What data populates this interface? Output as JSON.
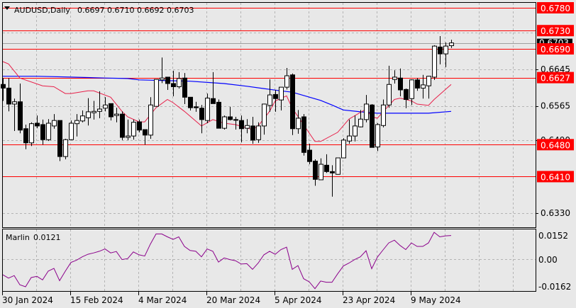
{
  "header": {
    "symbol_timeframe": "AUDUSD,Daily",
    "ohlc": "0.6697 0.6710 0.6692 0.6703"
  },
  "colors": {
    "background": "#e8e8e8",
    "levels": "#ff0000",
    "ma_fast": "#e8204a",
    "ma_slow": "#0000ff",
    "indicator": "#8b008b",
    "bull_body": "#ffffff",
    "bear_body": "#000000"
  },
  "chart_data": [
    {
      "type": "candlestick",
      "title": "AUDUSD,Daily",
      "ylim": [
        0.629,
        0.68
      ],
      "grid": true,
      "x_tick_labels": [
        {
          "bar": 0,
          "label": "30 Jan 2024"
        },
        {
          "bar": 12,
          "label": "15 Feb 2024"
        },
        {
          "bar": 24,
          "label": "4 Mar 2024"
        },
        {
          "bar": 36,
          "label": "20 Mar 2024"
        },
        {
          "bar": 48,
          "label": "5 Apr 2024"
        },
        {
          "bar": 60,
          "label": "23 Apr 2024"
        },
        {
          "bar": 72,
          "label": "9 May 2024"
        }
      ],
      "y_tick_labels": [
        "0.6645",
        "0.6565",
        "0.6490",
        "0.6330"
      ],
      "y_grid": [
        0.6725,
        0.6645,
        0.6565,
        0.649,
        0.641,
        0.633
      ],
      "levels": [
        "0.6780",
        "0.6730",
        "0.6690",
        "0.6627",
        "0.6480",
        "0.6410"
      ],
      "current_price": "0.6703",
      "ohlc": [
        [
          0.6612,
          0.6626,
          0.6576,
          0.6604
        ],
        [
          0.6604,
          0.6626,
          0.6553,
          0.6569
        ],
        [
          0.6569,
          0.6581,
          0.651,
          0.6574
        ],
        [
          0.6574,
          0.6614,
          0.6505,
          0.6512
        ],
        [
          0.6515,
          0.6524,
          0.647,
          0.6484
        ],
        [
          0.6484,
          0.6529,
          0.6477,
          0.6526
        ],
        [
          0.6527,
          0.6544,
          0.6516,
          0.6521
        ],
        [
          0.6524,
          0.6535,
          0.648,
          0.6491
        ],
        [
          0.6491,
          0.6536,
          0.6488,
          0.6527
        ],
        [
          0.6521,
          0.6547,
          0.6515,
          0.6533
        ],
        [
          0.6533,
          0.6533,
          0.6444,
          0.6454
        ],
        [
          0.6454,
          0.6493,
          0.6448,
          0.6491
        ],
        [
          0.6491,
          0.6533,
          0.649,
          0.6527
        ],
        [
          0.6526,
          0.6547,
          0.6498,
          0.6533
        ],
        [
          0.6532,
          0.6555,
          0.6529,
          0.6543
        ],
        [
          0.6539,
          0.6582,
          0.6522,
          0.6552
        ],
        [
          0.655,
          0.6576,
          0.6535,
          0.6553
        ],
        [
          0.6553,
          0.6597,
          0.6538,
          0.6558
        ],
        [
          0.656,
          0.6584,
          0.6553,
          0.6567
        ],
        [
          0.657,
          0.657,
          0.6533,
          0.6541
        ],
        [
          0.6544,
          0.6561,
          0.6529,
          0.6547
        ],
        [
          0.6547,
          0.6553,
          0.649,
          0.6496
        ],
        [
          0.6496,
          0.6535,
          0.649,
          0.6499
        ],
        [
          0.6499,
          0.6535,
          0.6491,
          0.6529
        ],
        [
          0.653,
          0.6535,
          0.6507,
          0.6512
        ],
        [
          0.6513,
          0.6513,
          0.648,
          0.6501
        ],
        [
          0.6501,
          0.6584,
          0.6493,
          0.6567
        ],
        [
          0.6564,
          0.6623,
          0.6564,
          0.6623
        ],
        [
          0.6622,
          0.6671,
          0.6615,
          0.6626
        ],
        [
          0.6628,
          0.6628,
          0.66,
          0.6614
        ],
        [
          0.6614,
          0.6642,
          0.6586,
          0.6607
        ],
        [
          0.6607,
          0.6639,
          0.6603,
          0.6625
        ],
        [
          0.6626,
          0.6637,
          0.6569,
          0.6584
        ],
        [
          0.6584,
          0.6584,
          0.6555,
          0.6561
        ],
        [
          0.6563,
          0.6574,
          0.6552,
          0.6561
        ],
        [
          0.656,
          0.6567,
          0.6505,
          0.6535
        ],
        [
          0.6533,
          0.6592,
          0.6527,
          0.6582
        ],
        [
          0.6581,
          0.6639,
          0.657,
          0.657
        ],
        [
          0.6573,
          0.6579,
          0.6516,
          0.6516
        ],
        [
          0.6516,
          0.6544,
          0.6513,
          0.6541
        ],
        [
          0.6541,
          0.6563,
          0.6533,
          0.6535
        ],
        [
          0.6535,
          0.6541,
          0.6513,
          0.6535
        ],
        [
          0.6533,
          0.6544,
          0.6485,
          0.6515
        ],
        [
          0.6516,
          0.6536,
          0.6505,
          0.6522
        ],
        [
          0.6521,
          0.6541,
          0.6482,
          0.649
        ],
        [
          0.6491,
          0.6529,
          0.6484,
          0.6521
        ],
        [
          0.6521,
          0.657,
          0.6502,
          0.6569
        ],
        [
          0.6566,
          0.6623,
          0.6552,
          0.6589
        ],
        [
          0.659,
          0.66,
          0.6552,
          0.6581
        ],
        [
          0.6578,
          0.6606,
          0.6555,
          0.6606
        ],
        [
          0.6606,
          0.6648,
          0.6601,
          0.6631
        ],
        [
          0.6633,
          0.6636,
          0.6501,
          0.6515
        ],
        [
          0.6515,
          0.6556,
          0.6504,
          0.6538
        ],
        [
          0.6541,
          0.6547,
          0.6456,
          0.6463
        ],
        [
          0.6468,
          0.6482,
          0.6437,
          0.6443
        ],
        [
          0.6444,
          0.6448,
          0.639,
          0.6404
        ],
        [
          0.6403,
          0.645,
          0.6403,
          0.6437
        ],
        [
          0.6435,
          0.6459,
          0.6418,
          0.6421
        ],
        [
          0.6421,
          0.6435,
          0.6366,
          0.6418
        ],
        [
          0.6415,
          0.6451,
          0.6414,
          0.6451
        ],
        [
          0.6451,
          0.6494,
          0.6451,
          0.649
        ],
        [
          0.6488,
          0.6535,
          0.6482,
          0.6499
        ],
        [
          0.6499,
          0.6544,
          0.6487,
          0.6521
        ],
        [
          0.6519,
          0.6556,
          0.6518,
          0.6536
        ],
        [
          0.6535,
          0.6589,
          0.6529,
          0.6569
        ],
        [
          0.6567,
          0.6569,
          0.6474,
          0.6474
        ],
        [
          0.6475,
          0.6527,
          0.6466,
          0.6524
        ],
        [
          0.6522,
          0.6579,
          0.6518,
          0.6567
        ],
        [
          0.6567,
          0.6653,
          0.6561,
          0.6612
        ],
        [
          0.6623,
          0.6643,
          0.6614,
          0.6628
        ],
        [
          0.6626,
          0.6647,
          0.6586,
          0.66
        ],
        [
          0.6601,
          0.6603,
          0.656,
          0.6579
        ],
        [
          0.6581,
          0.6623,
          0.6567,
          0.6622
        ],
        [
          0.6622,
          0.6626,
          0.6598,
          0.6604
        ],
        [
          0.6604,
          0.6633,
          0.6581,
          0.6611
        ],
        [
          0.6609,
          0.6631,
          0.6581,
          0.663
        ],
        [
          0.6628,
          0.6698,
          0.6622,
          0.6696
        ],
        [
          0.6694,
          0.6718,
          0.6656,
          0.6679
        ],
        [
          0.6679,
          0.6704,
          0.665,
          0.6696
        ],
        [
          0.6697,
          0.671,
          0.6692,
          0.6703
        ]
      ],
      "ma_fast": [
        [
          0,
          0.6662
        ],
        [
          1,
          0.6657
        ],
        [
          3,
          0.6626
        ],
        [
          7,
          0.6609
        ],
        [
          9,
          0.6607
        ],
        [
          11,
          0.6592
        ],
        [
          12,
          0.6592
        ],
        [
          15,
          0.6598
        ],
        [
          16,
          0.6598
        ],
        [
          19,
          0.6584
        ],
        [
          21,
          0.6553
        ],
        [
          22,
          0.6541
        ],
        [
          24,
          0.653
        ],
        [
          25,
          0.653
        ],
        [
          27,
          0.6561
        ],
        [
          29,
          0.6579
        ],
        [
          30,
          0.6572
        ],
        [
          32,
          0.6553
        ],
        [
          35,
          0.6521
        ],
        [
          37,
          0.6535
        ],
        [
          39,
          0.6527
        ],
        [
          41,
          0.6524
        ],
        [
          44,
          0.6513
        ],
        [
          45,
          0.6521
        ],
        [
          47,
          0.6553
        ],
        [
          48,
          0.6576
        ],
        [
          50,
          0.6587
        ],
        [
          51,
          0.656
        ],
        [
          55,
          0.6487
        ],
        [
          56,
          0.6487
        ],
        [
          59,
          0.6507
        ],
        [
          61,
          0.6536
        ],
        [
          64,
          0.6558
        ],
        [
          65,
          0.6541
        ],
        [
          66,
          0.6538
        ],
        [
          67,
          0.6552
        ],
        [
          69,
          0.6579
        ],
        [
          70,
          0.6582
        ],
        [
          72,
          0.6576
        ],
        [
          73,
          0.6569
        ],
        [
          75,
          0.6566
        ],
        [
          76,
          0.6579
        ],
        [
          79,
          0.6612
        ]
      ],
      "ma_slow": [
        [
          0,
          0.663
        ],
        [
          6,
          0.663
        ],
        [
          12,
          0.6628
        ],
        [
          18,
          0.6626
        ],
        [
          22,
          0.6625
        ],
        [
          24,
          0.6622
        ],
        [
          33,
          0.6619
        ],
        [
          39,
          0.6614
        ],
        [
          43,
          0.6608
        ],
        [
          46,
          0.6603
        ],
        [
          49,
          0.6598
        ],
        [
          51,
          0.6595
        ],
        [
          56,
          0.6577
        ],
        [
          58,
          0.6567
        ],
        [
          60,
          0.6556
        ],
        [
          63,
          0.6552
        ],
        [
          66,
          0.6549
        ],
        [
          75,
          0.6549
        ],
        [
          79,
          0.6553
        ]
      ]
    },
    {
      "type": "line",
      "name": "Marlin",
      "current_value": "0.0121",
      "ylim": [
        -0.0162,
        0.0152
      ],
      "y_tick_labels": [
        "0.0152",
        "0.00",
        "-0.0162"
      ],
      "values": [
        -0.008,
        -0.0097,
        -0.0084,
        -0.0131,
        -0.0141,
        -0.0094,
        -0.0088,
        -0.0106,
        -0.0061,
        -0.0047,
        -0.011,
        -0.0062,
        -0.0017,
        -0.0005,
        0.0012,
        0.0025,
        0.0032,
        0.004,
        0.0052,
        0.0032,
        0.0039,
        -0.0002,
        0.0003,
        0.0037,
        0.0022,
        0.0016,
        0.0077,
        0.0129,
        0.0129,
        0.0114,
        0.0101,
        0.0114,
        0.0065,
        0.0044,
        0.004,
        0.0012,
        0.0052,
        0.004,
        -0.0015,
        0.0006,
        -0.0002,
        -0.0008,
        -0.0025,
        -0.0023,
        -0.0052,
        -0.002,
        0.0022,
        0.004,
        0.0025,
        0.0049,
        0.0061,
        -0.0052,
        -0.0033,
        -0.01,
        -0.0116,
        -0.0151,
        -0.0112,
        -0.0118,
        -0.0118,
        -0.0075,
        -0.0035,
        -0.002,
        -0.0002,
        0.0012,
        0.0043,
        -0.0049,
        0.001,
        0.0047,
        0.0083,
        0.0097,
        0.007,
        0.0049,
        0.0083,
        0.0065,
        0.0065,
        0.0083,
        0.0137,
        0.0114,
        0.0119,
        0.0121
      ]
    }
  ]
}
